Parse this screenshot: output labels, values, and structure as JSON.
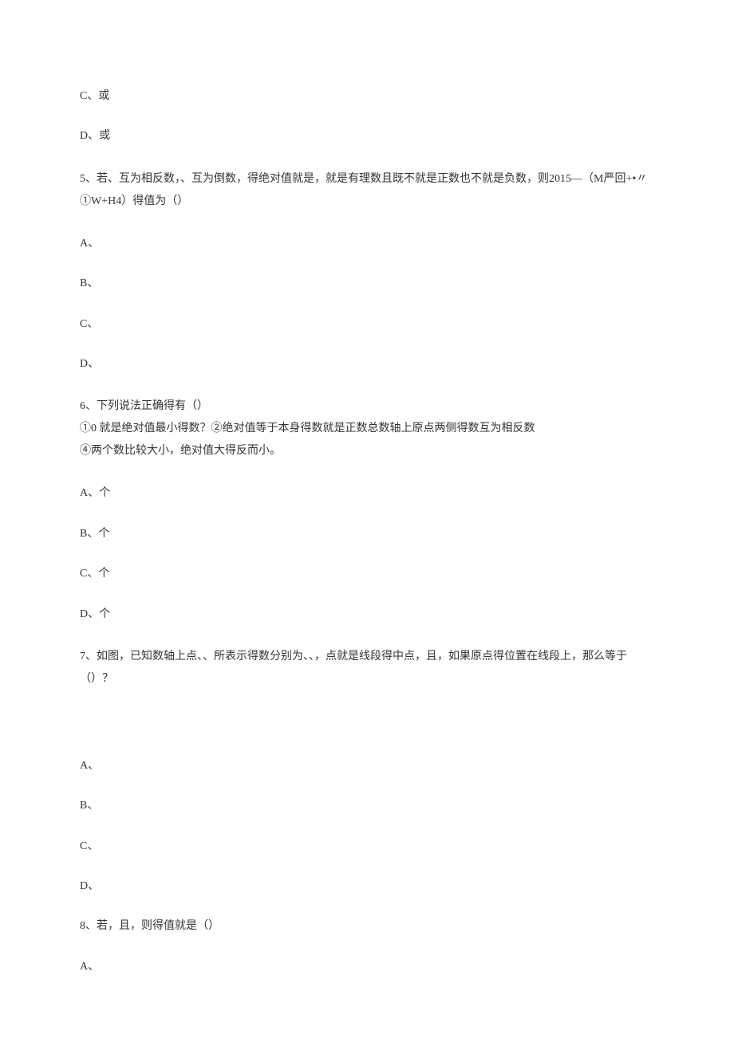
{
  "q4": {
    "optC": "C、或",
    "optD": "D、或"
  },
  "q5": {
    "text": "5、若、互为相反数，、互为倒数，得绝对值就是，就是有理数且既不就是正数也不就是负数，则2015—（M严回+•〃①W+H4）得值为（）",
    "optA": "A、",
    "optB": "B、",
    "optC": "C、",
    "optD": "D、"
  },
  "q6": {
    "line1": "6、下列说法正确得有（）",
    "line2": "①0 就是绝对值最小得数？②绝对值等于本身得数就是正数总数轴上原点两侧得数互为相反数",
    "line3": "④两个数比较大小，绝对值大得反而小。",
    "optA": "A、个",
    "optB": "B、个",
    "optC": "C、个",
    "optD": "D、个"
  },
  "q7": {
    "text": "7、如图，已知数轴上点、、所表示得数分别为、、，点就是线段得中点，且，如果原点得位置在线段上，那么等于（）？",
    "optA": "A、",
    "optB": "B、",
    "optC": "C、",
    "optD": "D、"
  },
  "q8": {
    "text": "8、若，且，则得值就是（）",
    "optA": "A、"
  }
}
